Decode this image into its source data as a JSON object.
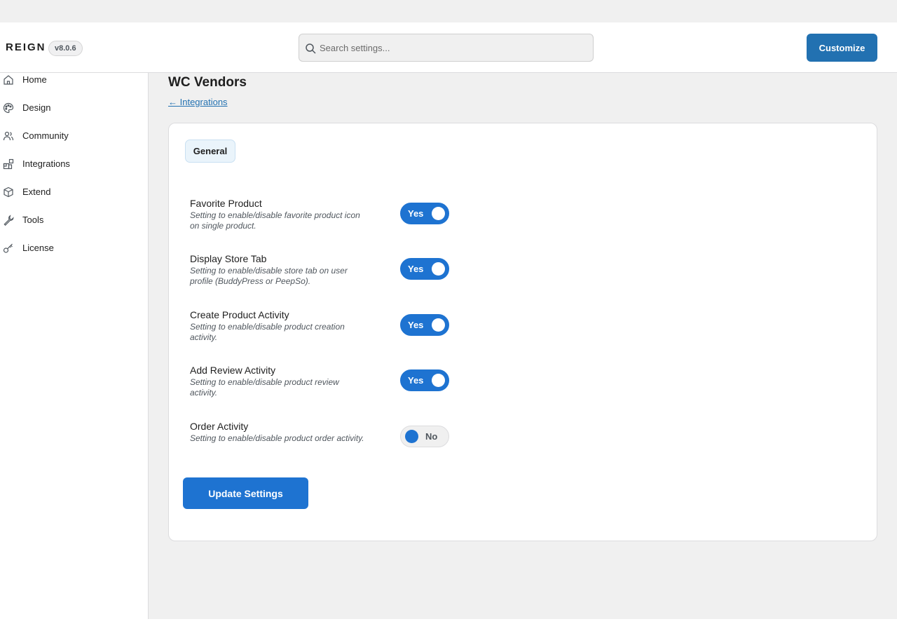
{
  "header": {
    "brand": "REIGN",
    "version": "v8.0.6",
    "search_placeholder": "Search settings...",
    "customize_label": "Customize"
  },
  "sidebar": {
    "items": [
      {
        "label": "Home",
        "icon": "home-icon"
      },
      {
        "label": "Design",
        "icon": "palette-icon"
      },
      {
        "label": "Community",
        "icon": "users-icon"
      },
      {
        "label": "Integrations",
        "icon": "blocks-icon"
      },
      {
        "label": "Extend",
        "icon": "box-icon"
      },
      {
        "label": "Tools",
        "icon": "wrench-icon"
      },
      {
        "label": "License",
        "icon": "key-icon"
      }
    ]
  },
  "main": {
    "title": "WC Vendors",
    "back_link": "← Integrations",
    "tabs": [
      {
        "label": "General",
        "active": true
      }
    ],
    "settings": [
      {
        "title": "Favorite Product",
        "description": "Setting to enable/disable favorite product icon on single product.",
        "value": "Yes",
        "enabled": true
      },
      {
        "title": "Display Store Tab",
        "description": "Setting to enable/disable store tab on user profile (BuddyPress or PeepSo).",
        "value": "Yes",
        "enabled": true
      },
      {
        "title": "Create Product Activity",
        "description": "Setting to enable/disable product creation activity.",
        "value": "Yes",
        "enabled": true
      },
      {
        "title": "Add Review Activity",
        "description": "Setting to enable/disable product review activity.",
        "value": "Yes",
        "enabled": true
      },
      {
        "title": "Order Activity",
        "description": "Setting to enable/disable product order activity.",
        "value": "No",
        "enabled": false
      }
    ],
    "update_label": "Update Settings"
  },
  "colors": {
    "accent": "#1e73d1",
    "customize_button": "#2271b1",
    "link": "#2271b1"
  }
}
